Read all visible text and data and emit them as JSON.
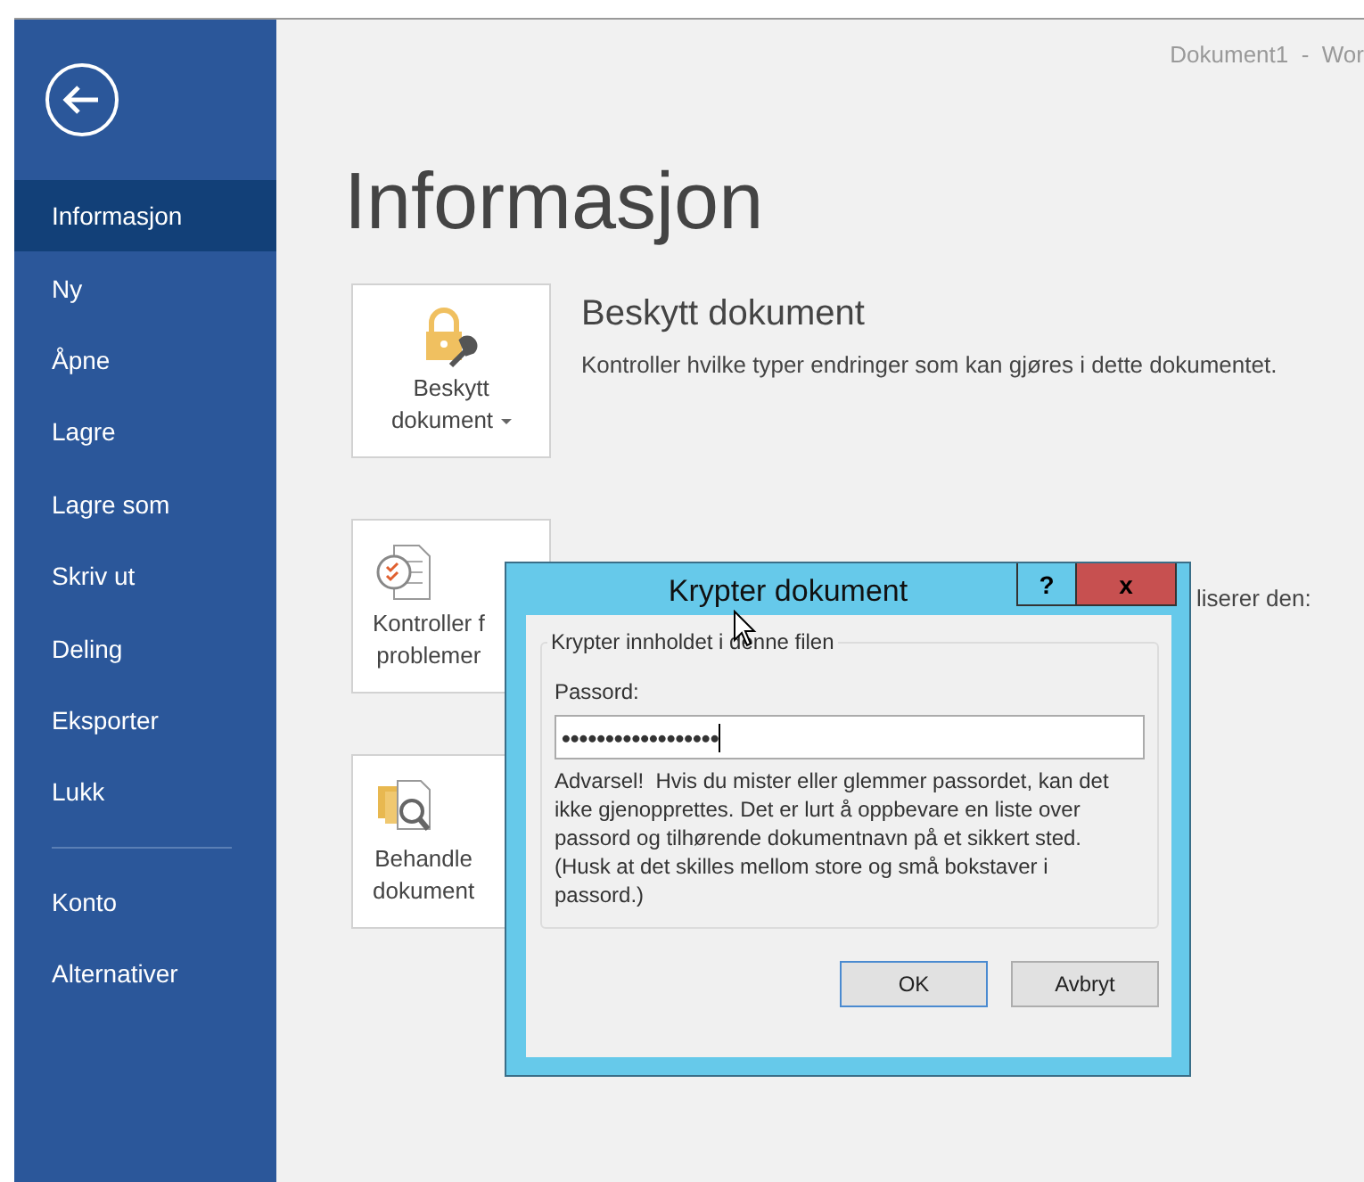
{
  "window": {
    "title": "Dokument1  -  Wor"
  },
  "sidebar": {
    "items": [
      {
        "label": "Informasjon",
        "selected": true
      },
      {
        "label": "Ny",
        "selected": false
      },
      {
        "label": "Åpne",
        "selected": false
      },
      {
        "label": "Lagre",
        "selected": false
      },
      {
        "label": "Lagre som",
        "selected": false
      },
      {
        "label": "Skriv ut",
        "selected": false
      },
      {
        "label": "Deling",
        "selected": false
      },
      {
        "label": "Eksporter",
        "selected": false
      },
      {
        "label": "Lukk",
        "selected": false
      }
    ],
    "footer_items": [
      {
        "label": "Konto",
        "selected": false
      },
      {
        "label": "Alternativer",
        "selected": false
      }
    ]
  },
  "page": {
    "heading": "Informasjon",
    "sections": [
      {
        "button_lines": [
          "Beskytt",
          "dokument"
        ],
        "dropdown": true,
        "title": "Beskytt dokument",
        "description": "Kontroller hvilke typer endringer som kan gjøres i dette dokumentet."
      },
      {
        "button_lines": [
          "Kontroller f",
          "problemer"
        ],
        "dropdown": false,
        "description": "liserer den:"
      },
      {
        "button_lines": [
          "Behandle",
          "dokument"
        ],
        "dropdown": false
      }
    ]
  },
  "dialog": {
    "title": "Krypter dokument",
    "help": "?",
    "close": "x",
    "group_label": "Krypter innholdet i denne filen",
    "password_label": "Passord:",
    "password_value": "••••••••••••••••••",
    "warning": "Advarsel!  Hvis du mister eller glemmer passordet, kan det ikke gjenopprettes. Det er lurt å oppbevare en liste over passord og tilhørende dokumentnavn på et sikkert sted.",
    "note": "(Husk at det skilles mellom store og små bokstaver i passord.)",
    "buttons": [
      {
        "label": "OK",
        "default": true
      },
      {
        "label": "Avbryt",
        "default": false
      }
    ]
  }
}
